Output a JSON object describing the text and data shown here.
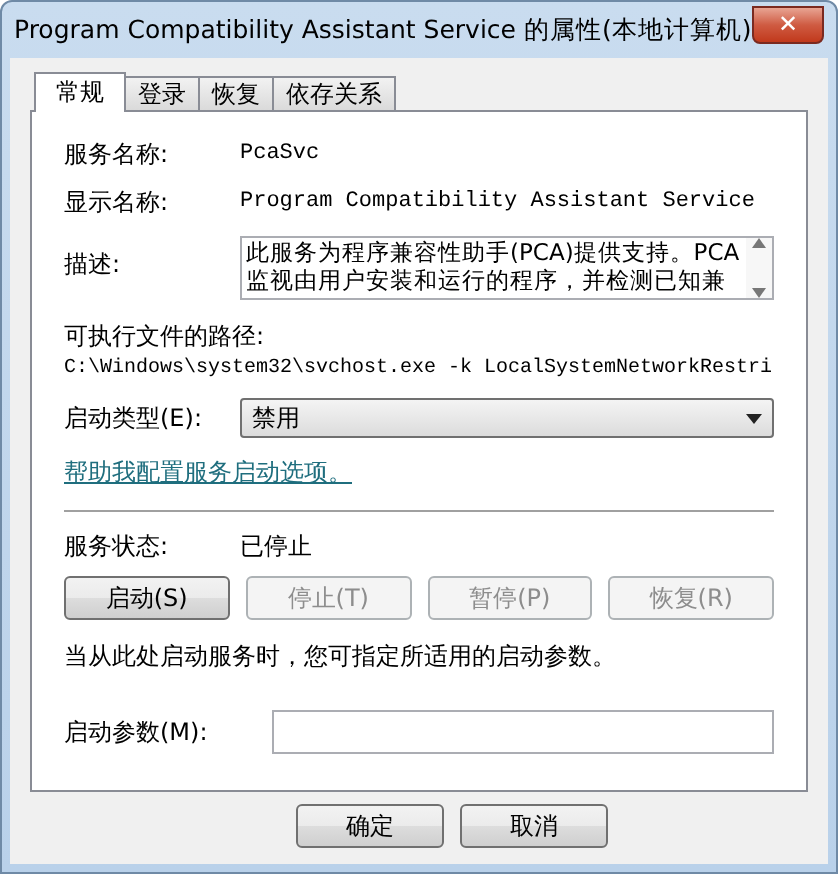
{
  "window": {
    "title": "Program Compatibility Assistant Service 的属性(本地计算机)",
    "close": "✕"
  },
  "tabs": [
    {
      "label": "常规",
      "selected": true
    },
    {
      "label": "登录",
      "selected": false
    },
    {
      "label": "恢复",
      "selected": false
    },
    {
      "label": "依存关系",
      "selected": false
    }
  ],
  "fields": [
    {
      "label": "服务名称:",
      "value": "PcaSvc"
    },
    {
      "label": "显示名称:",
      "value": "Program Compatibility Assistant Service"
    }
  ],
  "description": {
    "label": "描述:",
    "lines": [
      "此服务为程序兼容性助手(PCA)提供支持。PCA",
      "监视由用户安装和运行的程序，并检测已知兼"
    ]
  },
  "path": {
    "label": "可执行文件的路径:",
    "value": "C:\\Windows\\system32\\svchost.exe -k LocalSystemNetworkRestri"
  },
  "startup_type": {
    "label": "启动类型(E):",
    "value": "禁用"
  },
  "help_link": "帮助我配置服务启动选项。",
  "status": {
    "label": "服务状态:",
    "value": "已停止"
  },
  "service_buttons": [
    {
      "label": "启动(S)",
      "disabled": false
    },
    {
      "label": "停止(T)",
      "disabled": true
    },
    {
      "label": "暂停(P)",
      "disabled": true
    },
    {
      "label": "恢复(R)",
      "disabled": true
    }
  ],
  "hint": "当从此处启动服务时，您可指定所适用的启动参数。",
  "parameters": {
    "label": "启动参数(M):"
  },
  "dialog_buttons": [
    {
      "label": "确定",
      "disabled": false
    },
    {
      "label": "取消",
      "disabled": false
    }
  ]
}
